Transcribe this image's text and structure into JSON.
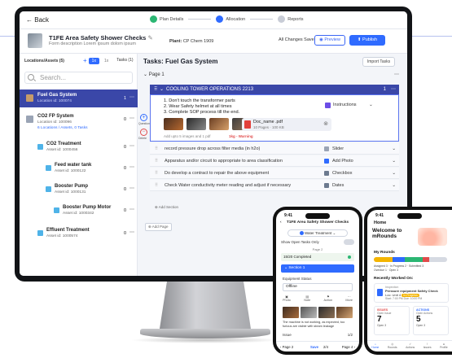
{
  "colors": {
    "primary": "#2f6bff",
    "section": "#3a47a8",
    "success": "#2bb673",
    "warning": "#f0a020",
    "danger": "#e14b4b",
    "accent_line": "#7c8ee0"
  },
  "topbar": {
    "back_label": "Back",
    "steps": [
      {
        "label": "Plan Details",
        "state": "done"
      },
      {
        "label": "Allocation",
        "state": "active"
      },
      {
        "label": "Reports",
        "state": "pending"
      }
    ]
  },
  "header": {
    "title": "T1FE Area Safety Shower Checks",
    "description": "Form description Lorem ipsum dolom ipsum",
    "plant_label": "Plant:",
    "plant_value": "CP Chem 1909",
    "save_status": "All Changes Saved",
    "preview_label": "Preview",
    "publish_label": "Publish"
  },
  "sidebar": {
    "heading": "Locations/Assets (5)",
    "tab_on": "1x",
    "tab_off": "1x",
    "tasks_label": "Tasks (1)",
    "search_placeholder": "Search...",
    "items": [
      {
        "name": "Fuel Gas System",
        "sub": "Location id: 100074",
        "count": "1",
        "active": true
      },
      {
        "name": "CO2 FP System",
        "sub": "Location id: 100096",
        "extra": "6 Locations / Assets, 0 Tasks",
        "count": "0"
      },
      {
        "name": "CO2 Treatment",
        "sub": "Asset id: 1000456",
        "count": "0"
      },
      {
        "name": "Feed water tank",
        "sub": "Asset id: 1000122",
        "count": "0"
      },
      {
        "name": "Booster Pump",
        "sub": "Asset id: 1000131",
        "count": "0"
      },
      {
        "name": "Booster Pump Motor",
        "sub": "Asset id: 1000342",
        "count": "0"
      },
      {
        "name": "Effluent Treatment",
        "sub": "Asset id: 1000574",
        "count": "0"
      }
    ]
  },
  "main": {
    "tasks_title": "Tasks: Fuel Gas System",
    "import_label": "Import Tasks",
    "page_label": "Page 1",
    "section_title": "COOLING TOWER OPERATIONS 2213",
    "section_count": "1",
    "instructions": [
      "1. Don't touch the transformer parts",
      "2. Wear Safety helmet at all times",
      "3. Complete SOP process till the end."
    ],
    "instructions_type": "Instructions",
    "doc_name": "Doc_name .pdf",
    "doc_pages": "10 Pages",
    "doc_size": "100 KB",
    "add_images_hint": "Add upto 5 images and 1 pdf",
    "flag_label": "1kg - Warning",
    "question_label": "Question",
    "delete_label": "Delete",
    "rows": [
      {
        "text": "record pressure drop across filter media (in h2o)",
        "type": "Slider"
      },
      {
        "text": "Apparatus and/or circuit to appropriate to area classification",
        "type": "Add Photo"
      },
      {
        "text": "Do develop a contract to repair the above equipment",
        "type": "Checkbox"
      },
      {
        "text": "Check Water conductivity meter reading and adjust if necessary",
        "type": "Dates"
      }
    ],
    "add_section_label": "Add Section",
    "add_page_label": "Add Page"
  },
  "phone1": {
    "time": "9:41",
    "title": "T1FE Area Safety Shower Checks",
    "location_chip": "Water Treatment",
    "toggle_label": "Show Open Tasks Only",
    "page_label": "Page 2",
    "progress_label": "15/20 Completed",
    "section_label": "Section 1",
    "field_label": "Equipment Status",
    "field_value": "Offline",
    "actions": [
      "Photo",
      "Note",
      "Action",
      "More"
    ],
    "note_text": "The machine is not working, as expected, too furious are visible with steam leakage",
    "issue_label": "Issue",
    "issue_count": "1/2",
    "footer_prev": "Page 2",
    "footer_save": "Save",
    "footer_pages": "2/4",
    "footer_next": "Page 4"
  },
  "phone2": {
    "time": "9:41",
    "home_label": "Home",
    "welcome": "Welcome to mRounds",
    "my_rounds_label": "My Rounds",
    "legend": [
      "Assigned 3",
      "In Progress 2",
      "Submitted 3",
      "Overdue 1",
      "Open 3"
    ],
    "recent_label": "Recently Worked On:",
    "recent_kind": "Inspection",
    "recent_title": "Pressure equipment Safety Check",
    "recent_loc": "Loc: Unit 4",
    "recent_status": "In-Progress",
    "recent_time": "Start: 7:00 PM   Due: 10:00 PM",
    "issues_label": "ISSUES",
    "issues_sub": "Open Issue",
    "issues_count": "7",
    "issues_open": "Open 3",
    "actions_label": "ACTIONS",
    "actions_sub": "Open Actions",
    "actions_count": "5",
    "actions_open": "Open 3",
    "nav": [
      "Home",
      "Rounds",
      "Actions",
      "Issues",
      "Profile"
    ]
  }
}
